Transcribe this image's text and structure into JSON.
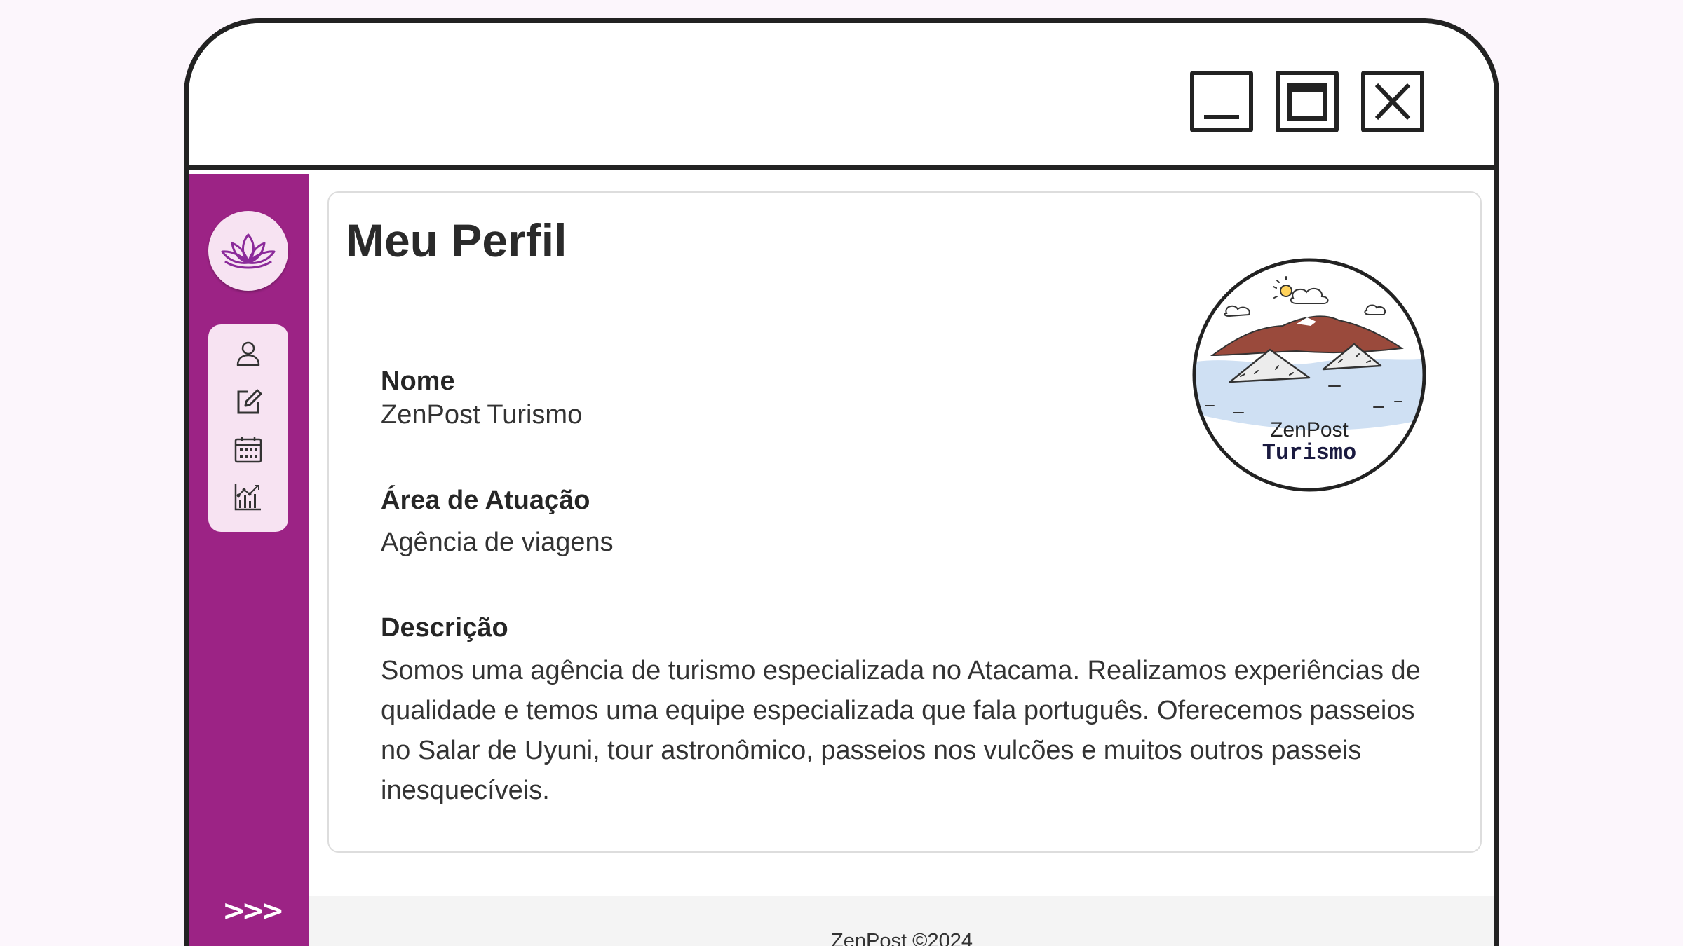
{
  "window": {
    "controls": {
      "minimize": "minimize-icon",
      "maximize": "maximize-icon",
      "close": "close-icon"
    }
  },
  "sidebar": {
    "color": "#9c2385",
    "logo_icon": "lotus-icon",
    "nav_items": [
      {
        "icon": "user-icon",
        "label": "Perfil"
      },
      {
        "icon": "edit-icon",
        "label": "Editar"
      },
      {
        "icon": "calendar-icon",
        "label": "Agenda"
      },
      {
        "icon": "analytics-icon",
        "label": "Análises"
      }
    ],
    "expand_label": ">>>"
  },
  "profile": {
    "title": "Meu Perfil",
    "image_icon": "company-logo-icon",
    "logo_text_line1": "ZenPost",
    "logo_text_line2": "Turismo",
    "fields": [
      {
        "label": "Nome",
        "value": "ZenPost Turismo"
      },
      {
        "label": "Área de Atuação",
        "value": "Agência de viagens"
      },
      {
        "label": "Descrição",
        "value": "Somos uma agência de turismo especializada no Atacama. Realizamos experiências de qualidade e temos uma equipe especializada que fala português. Oferecemos passeios no Salar de Uyuni, tour astronômico, passeios nos vulcões e muitos outros passeis inesquecíveis."
      }
    ]
  },
  "footer": {
    "text": "ZenPost ©2024"
  }
}
